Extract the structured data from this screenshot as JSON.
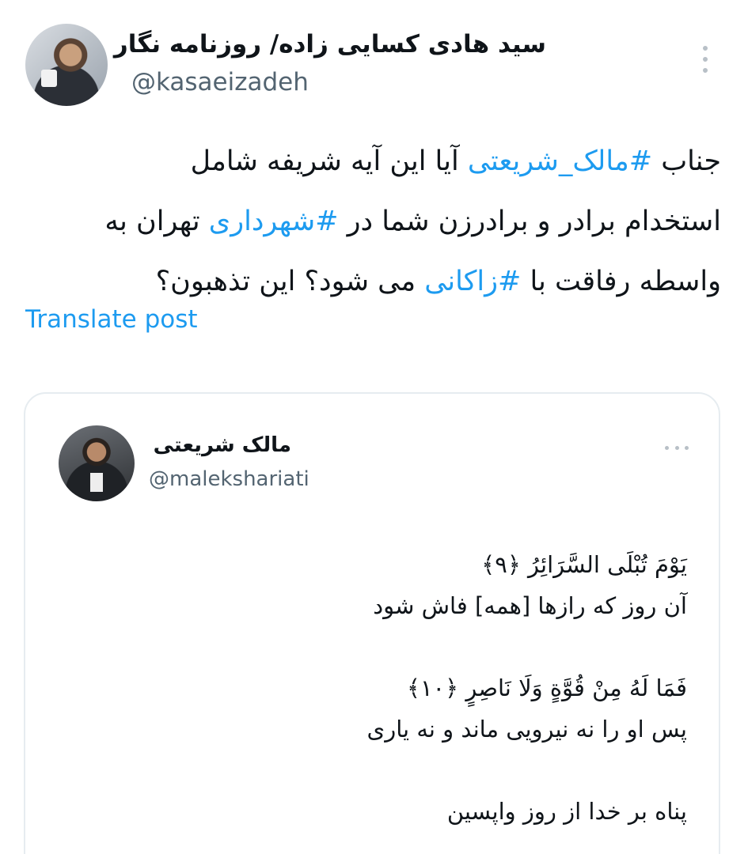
{
  "author": {
    "display_name": "سید هادی کسایی زاده/ روزنامه نگار",
    "handle": "@kasaeizadeh",
    "avatar_icon": "avatar-photo",
    "menu_icon": "more-vertical-icon"
  },
  "post": {
    "lines": [
      [
        "جناب ",
        "#مالک_شریعتی",
        " آیا این آیه شریفه شامل"
      ],
      [
        "استخدام برادر و برادرزن شما در ",
        "#شهرداری",
        " تهران به"
      ],
      [
        "واسطه رفاقت با ",
        "#زاکانی",
        " می شود؟ این تذهبون؟"
      ]
    ],
    "translate_label": "Translate post",
    "hashtag_color": "#1d9bf0"
  },
  "quoted": {
    "display_name": "مالک شریعتی",
    "handle": "@malekshariati",
    "menu_icon": "more-horizontal-icon",
    "verse1": "يَوْمَ تُبْلَى السَّرَائِرُ ﴿٩﴾",
    "trans1": "آن روز که رازها [همه] فاش شود",
    "verse2": "فَمَا لَهُ مِنْ قُوَّةٍ وَلَا نَاصِرٍ ﴿١٠﴾",
    "trans2": "پس او را نه نیرویی ماند و نه یاری",
    "closing": "پناه بر خدا از روز واپسین"
  }
}
